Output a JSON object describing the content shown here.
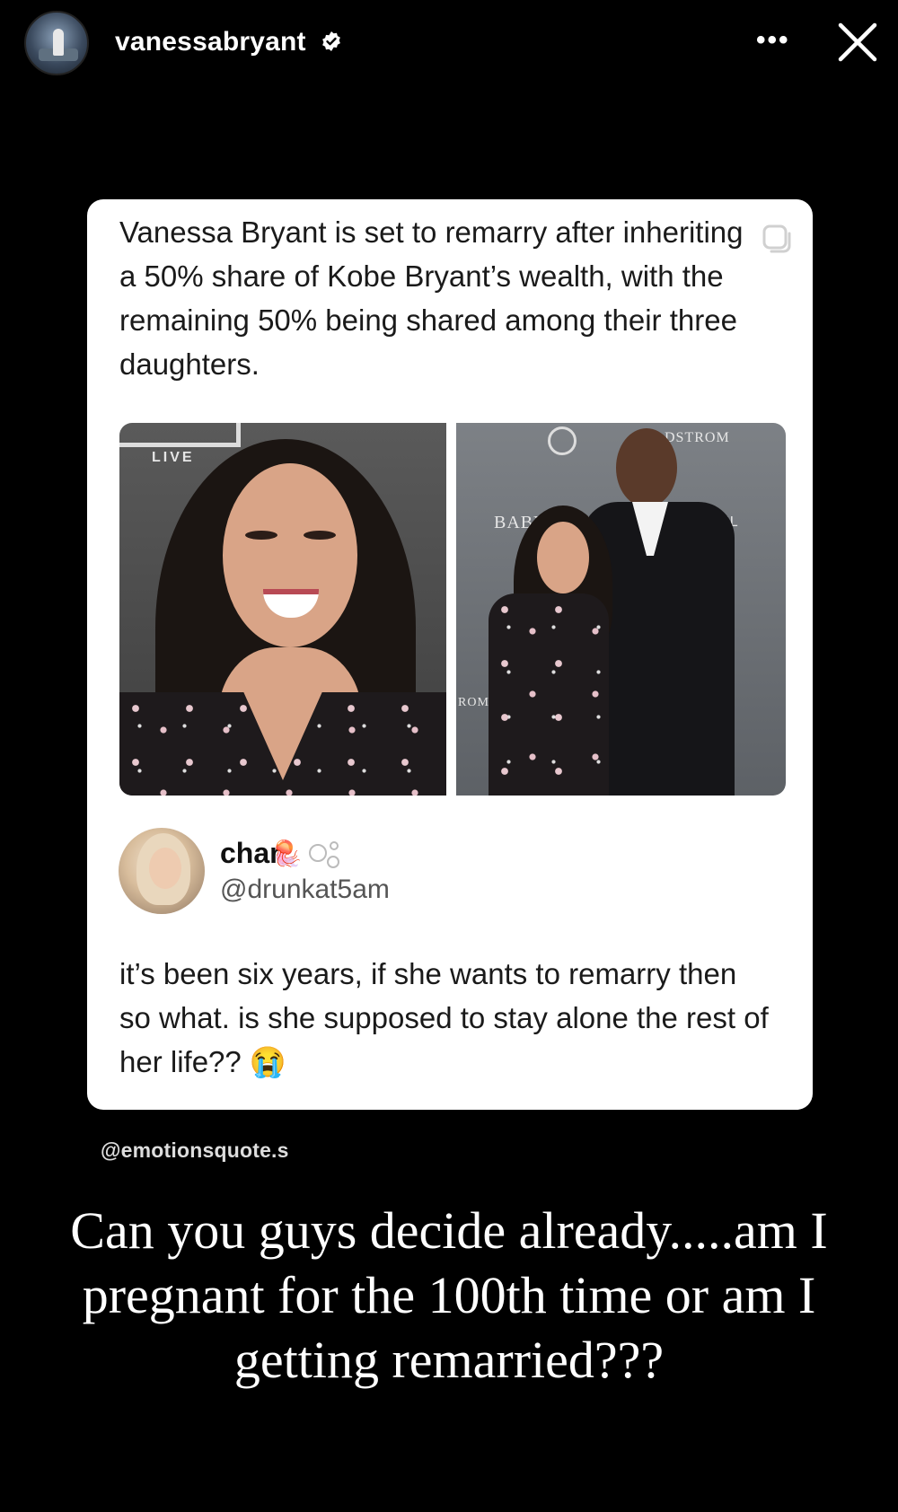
{
  "header": {
    "username": "vanessabryant",
    "verified_icon": "verified-badge-icon",
    "more_label": "•••",
    "close_icon": "close-icon"
  },
  "post": {
    "headline": "Vanessa Bryant is set to remarry after inheriting a 50% share of Kobe Bryant’s wealth, with the remaining 50% being shared among their three daughters.",
    "copy_icon": "copy-icon",
    "photo_left": {
      "backdrop_text": "LIVE"
    },
    "photo_right": {
      "backdrop_text_1": "DSTROM",
      "backdrop_text_2": "BABY2BABY",
      "backdrop_text_3": "PAUL",
      "backdrop_text_4": "ROM"
    },
    "reply": {
      "name": "char",
      "emoji": "🪼",
      "handle": "@drunkat5am",
      "text": "it’s been six years, if she wants to remarry then so what. is she supposed to stay alone the rest of her life?? 😭"
    }
  },
  "credit": "@emotionsquote.s",
  "caption": "Can you guys decide already.....am I pregnant for the 100th time or am I getting remarried???",
  "colors": {
    "background": "#000000",
    "card": "#ffffff",
    "verified": "#ffffff"
  }
}
